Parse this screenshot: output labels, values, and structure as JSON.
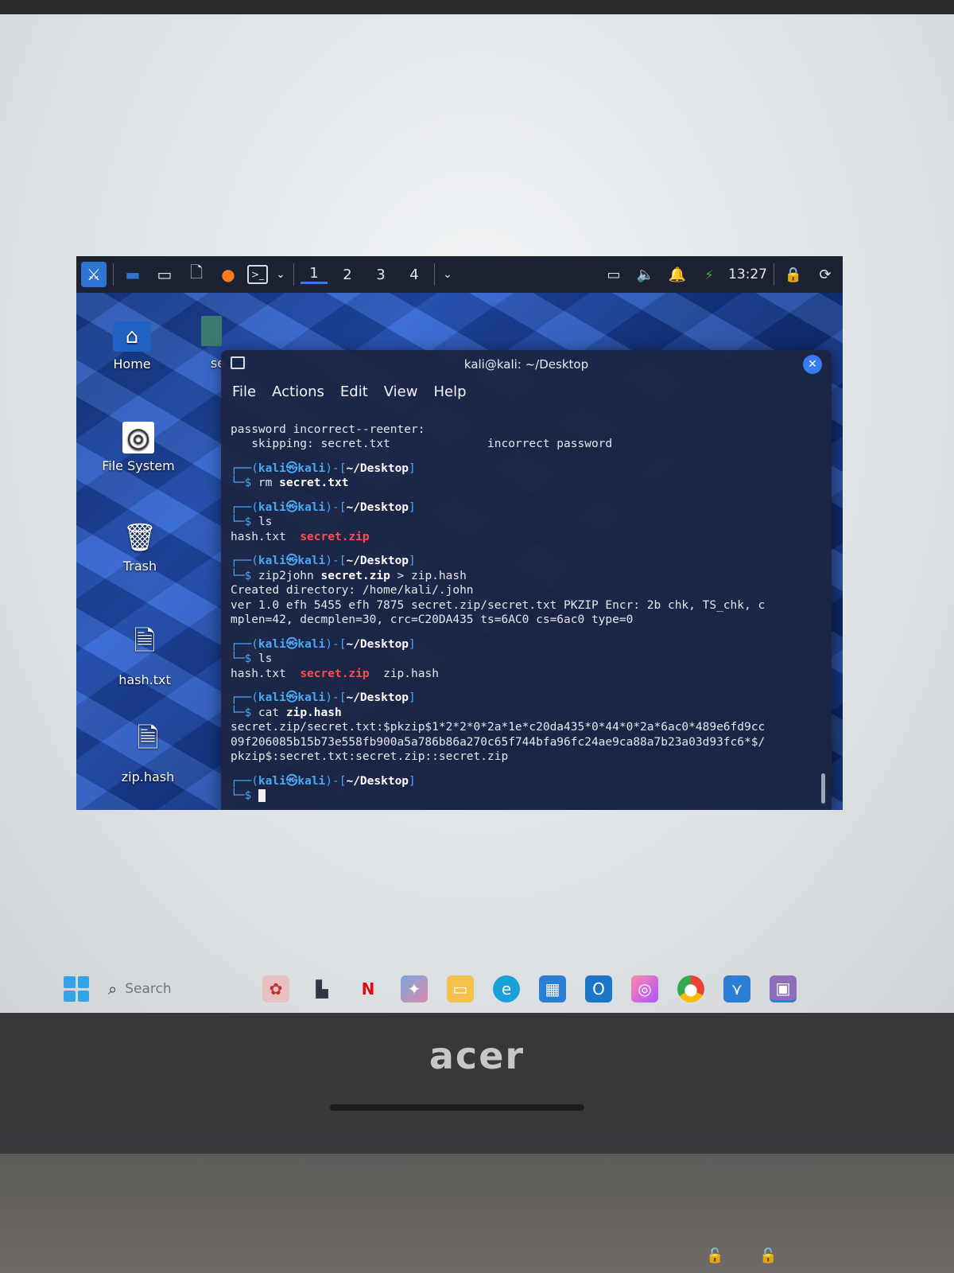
{
  "vm_panel": {
    "workspaces": [
      "1",
      "2",
      "3",
      "4"
    ],
    "active_workspace": "1",
    "clock": "13:27",
    "icons": [
      "kali-menu-icon",
      "desktop-icon",
      "files-icon",
      "text-editor-icon",
      "firefox-icon",
      "terminal-icon",
      "dropdown-icon",
      "display-icon",
      "volume-icon",
      "bell-icon",
      "battery-icon",
      "lock-icon",
      "logout-icon"
    ]
  },
  "desktop": {
    "icons": [
      {
        "label": "Home",
        "glyph": "⌂"
      },
      {
        "label": "File System",
        "glyph": "◎"
      },
      {
        "label": "Trash",
        "glyph": "🗑"
      },
      {
        "label": "hash.txt",
        "glyph": "🗎"
      },
      {
        "label": "zip.hash",
        "glyph": "🗎"
      }
    ],
    "partial_label": "se"
  },
  "terminal": {
    "title": "kali@kali: ~/Desktop",
    "menu": [
      "File",
      "Actions",
      "Edit",
      "View",
      "Help"
    ],
    "prompt_user": "kali",
    "prompt_at": "㉿",
    "prompt_host": "kali",
    "prompt_dir": "~/Desktop",
    "lines": {
      "l1": "password incorrect--reenter:",
      "l2": "   skipping: secret.txt              incorrect password",
      "cmd1": "rm",
      "cmd1_arg": "secret.txt",
      "cmd2": "ls",
      "ls1_a": "hash.txt",
      "ls1_b": "secret.zip",
      "cmd3": "zip2john",
      "cmd3_arg": "secret.zip",
      "cmd3_rest": "> zip.hash",
      "out3_1": "Created directory: /home/kali/.john",
      "out3_2": "ver 1.0 efh 5455 efh 7875 secret.zip/secret.txt PKZIP Encr: 2b chk, TS_chk, c",
      "out3_3": "mplen=42, decmplen=30, crc=C20DA435 ts=6AC0 cs=6ac0 type=0",
      "cmd4": "ls",
      "ls2_a": "hash.txt",
      "ls2_b": "secret.zip",
      "ls2_c": "zip.hash",
      "cmd5": "cat",
      "cmd5_arg": "zip.hash",
      "out5_1": "secret.zip/secret.txt:$pkzip$1*2*2*0*2a*1e*c20da435*0*44*0*2a*6ac0*489e6fd9cc",
      "out5_2": "09f206085b15b73e558fb900a5a786b86a270c65f744bfa96fc24ae9ca88a7b23a03d93fc6*$/",
      "out5_3": "pkzip$:secret.txt:secret.zip::secret.zip"
    }
  },
  "taskbar": {
    "search_placeholder": "Search",
    "apps": [
      "app-icon",
      "widgets-icon",
      "netflix-icon",
      "copilot-icon",
      "file-explorer-icon",
      "edge-icon",
      "store-icon",
      "outlook-icon",
      "instagram-icon",
      "chrome-icon",
      "vs-icon",
      "virtualbox-icon"
    ]
  },
  "laptop": {
    "brand": "acer"
  }
}
